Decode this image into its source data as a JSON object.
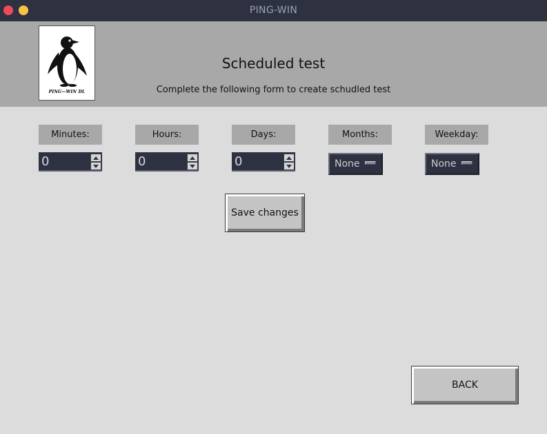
{
  "window": {
    "title": "PING-WIN"
  },
  "header": {
    "logo_text": "PING—WIN DL",
    "title": "Scheduled test",
    "subtitle": "Complete the following form to create schudled test"
  },
  "fields": {
    "minutes": {
      "label": "Minutes:",
      "value": "0"
    },
    "hours": {
      "label": "Hours:",
      "value": "0"
    },
    "days": {
      "label": "Days:",
      "value": "0"
    },
    "months": {
      "label": "Months:",
      "value": "None"
    },
    "weekday": {
      "label": "Weekday:",
      "value": "None"
    }
  },
  "buttons": {
    "save": "Save changes",
    "back": "BACK"
  },
  "colors": {
    "titlebar": "#2e3240",
    "header": "#a8a8a8",
    "background": "#dcdcdc",
    "close": "#ee4a5c",
    "minimize": "#f6c342",
    "input": "#2e3240"
  }
}
